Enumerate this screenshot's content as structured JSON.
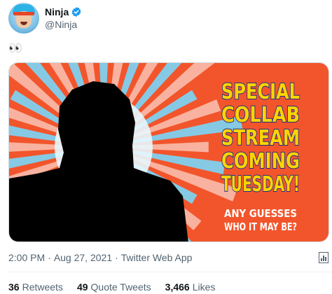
{
  "tweet": {
    "display_name": "Ninja",
    "handle": "@Ninja",
    "text": "👀",
    "time": "2:00 PM",
    "date": "Aug 27, 2021",
    "source": "Twitter Web App",
    "separator": "·",
    "media": {
      "headline_lines": [
        "SPECIAL",
        "COLLAB",
        "STREAM",
        "COMING",
        "TUESDAY!"
      ],
      "subline_lines": [
        "ANY GUESSES",
        "WHO IT MAY BE?"
      ],
      "colors": {
        "background": "#f2552b",
        "burst": "#7fd0ee",
        "headline_fill": "#ffd400",
        "headline_stroke": "#1b2a8c",
        "subline": "#ffffff",
        "silhouette": "#000000"
      }
    },
    "stats": {
      "retweets_count": "36",
      "retweets_label": "Retweets",
      "quotes_count": "49",
      "quotes_label": "Quote Tweets",
      "likes_count": "3,466",
      "likes_label": "Likes"
    },
    "icons": [
      "verified-badge-icon",
      "analytics-icon"
    ]
  }
}
